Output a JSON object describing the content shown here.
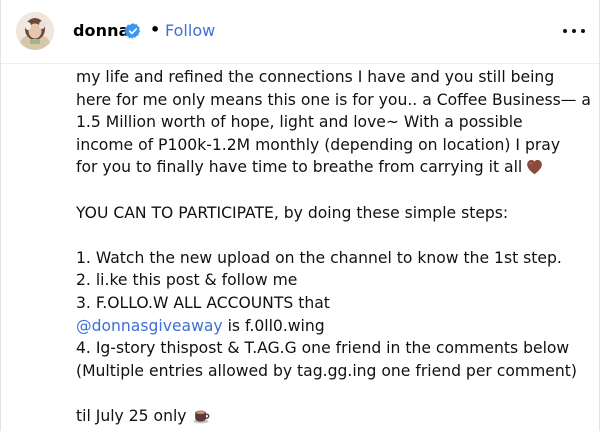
{
  "header": {
    "username": "donna",
    "separator": "•",
    "follow_label": "Follow",
    "avatar_icon": "profile-avatar",
    "verified_icon": "verified-badge-icon",
    "more_icon": "more-options-icon"
  },
  "caption": {
    "lines": [
      "my life and refined the connections I have and you still being",
      "here for me only means this one is for you.. a Coffee Business— a",
      "1.5 Million worth of hope, light and love~ With a possible",
      "income of P100k-1.2M monthly (depending on location) I pray",
      "for you to finally have time to breathe from carrying it all",
      "",
      "YOU CAN TO PARTICIPATE, by doing these simple steps:",
      "",
      "1. Watch the new upload on the channel to know the 1st step.",
      "2. li.ke this post & follow me",
      "3. F.OLLO.W ALL ACCOUNTS that",
      "",
      "4. Ig-story thispost & T.AG.G one friend in the comments below",
      "(Multiple entries allowed by tag.gg.ing one friend per comment)",
      "",
      "til July 25 only"
    ],
    "mention": "@donnasgiveaway",
    "mention_suffix": " is f.0ll0.wing",
    "heart_emoji": "brown-heart-icon",
    "cup_emoji": "coffee-cup-icon"
  },
  "colors": {
    "link": "#3f6fd8",
    "verified": "#3897f0",
    "heart": "#8a4b3c",
    "text": "#111111"
  }
}
